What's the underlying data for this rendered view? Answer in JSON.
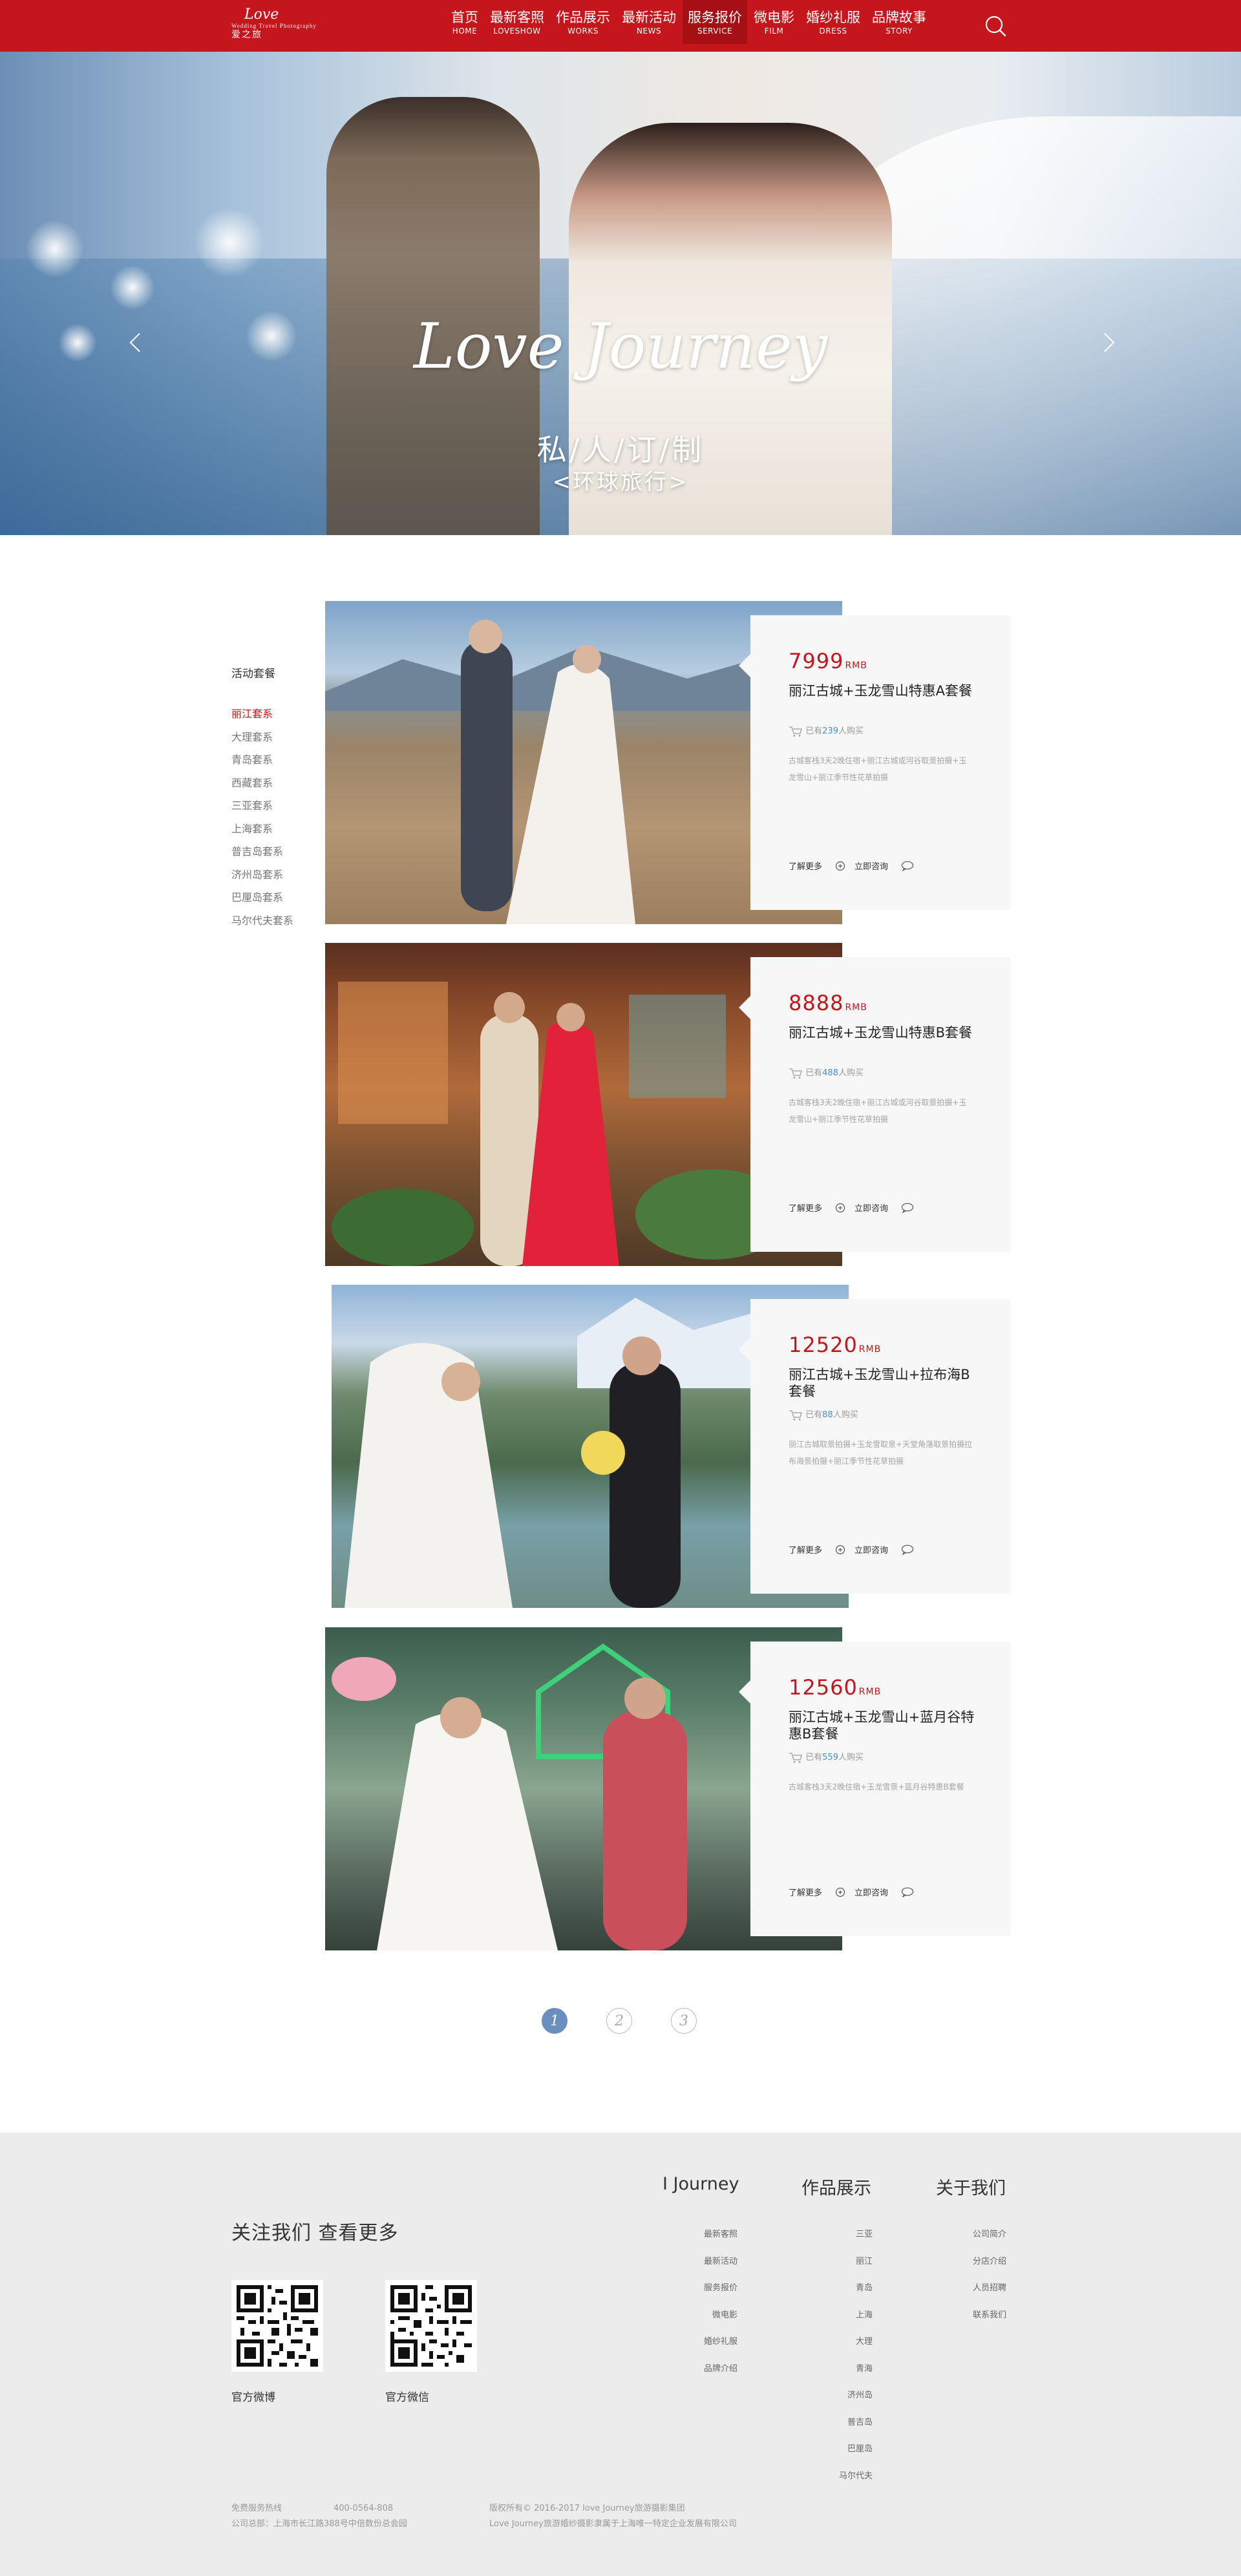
{
  "brand": {
    "script": "Love",
    "tagline": "Wedding Travel Photography",
    "name_cn": "爱之旅"
  },
  "nav": [
    {
      "cn": "首页",
      "en": "HOME",
      "active": false
    },
    {
      "cn": "最新客照",
      "en": "LOVESHOW",
      "active": false
    },
    {
      "cn": "作品展示",
      "en": "WORKS",
      "active": false
    },
    {
      "cn": "最新活动",
      "en": "NEWS",
      "active": false
    },
    {
      "cn": "服务报价",
      "en": "SERVICE",
      "active": true
    },
    {
      "cn": "微电影",
      "en": "FILM",
      "active": false
    },
    {
      "cn": "婚纱礼服",
      "en": "DRESS",
      "active": false
    },
    {
      "cn": "品牌故事",
      "en": "STORY",
      "active": false
    }
  ],
  "hero": {
    "script": "Love Journey",
    "title": "私/人/订/制",
    "subtitle": "<环球旅行>"
  },
  "sidebar": {
    "title": "活动套餐",
    "items": [
      "丽江套系",
      "大理套系",
      "青岛套系",
      "西藏套系",
      "三亚套系",
      "上海套系",
      "普吉岛套系",
      "济州岛套系",
      "巴厘岛套系",
      "马尔代夫套系"
    ]
  },
  "packages": [
    {
      "price": "7999",
      "unit": "RMB",
      "name": "丽江古城+玉龙雪山特惠A套餐",
      "buyers_pre": "已有",
      "buyers": "239",
      "buyers_post": "人购买",
      "desc": "古城客栈3天2晚住宿+丽江古城或河谷取景拍摄+玉龙雪山+丽江季节性花草拍摄",
      "more": "了解更多",
      "consult": "立即咨询"
    },
    {
      "price": "8888",
      "unit": "RMB",
      "name": "丽江古城+玉龙雪山特惠B套餐",
      "buyers_pre": "已有",
      "buyers": "488",
      "buyers_post": "人购买",
      "desc": "古城客栈3天2晚住宿+丽江古城或河谷取景拍摄+玉龙雪山+丽江季节性花草拍摄",
      "more": "了解更多",
      "consult": "立即咨询"
    },
    {
      "price": "12520",
      "unit": "RMB",
      "name": "丽江古城+玉龙雪山+拉布海B套餐",
      "buyers_pre": "已有",
      "buyers": "88",
      "buyers_post": "人购买",
      "desc": "丽江古城取景拍摄+玉龙雪取景+天堂角落取景拍摄拉布海景拍摄+丽江季节性花草拍摄",
      "more": "了解更多",
      "consult": "立即咨询"
    },
    {
      "price": "12560",
      "unit": "RMB",
      "name": "丽江古城+玉龙雪山+蓝月谷特惠B套餐",
      "buyers_pre": "已有",
      "buyers": "559",
      "buyers_post": "人购买",
      "desc": "古城客栈3天2晚住宿+玉龙雪景+蓝月谷特惠B套餐",
      "more": "了解更多",
      "consult": "立即咨询"
    }
  ],
  "pagination": [
    "1",
    "2",
    "3"
  ],
  "footer": {
    "follow": "关注我们 查看更多",
    "qr": [
      "官方微博",
      "官方微信"
    ],
    "columns": [
      {
        "title": "I Journey",
        "links": [
          "最新客照",
          "最新活动",
          "服务报价",
          "微电影",
          "婚纱礼服",
          "品牌介绍"
        ]
      },
      {
        "title": "作品展示",
        "links": [
          "三亚",
          "丽江",
          "青岛",
          "上海",
          "大理",
          "青海",
          "济州岛",
          "普吉岛",
          "巴厘岛",
          "马尔代夫"
        ]
      },
      {
        "title": "关于我们",
        "links": [
          "公司简介",
          "分店介绍",
          "人员招聘",
          "联系我们"
        ]
      }
    ],
    "hotline_label": "免费服务热线",
    "hotline": "400-0564-808",
    "address": "公司总部：上海市长江路388号中倍数份总会园",
    "copyright": "版权所有© 2016-2017 love Journey旅游摄影集团",
    "company": "Love Journey旅游婚纱摄影隶属于上海唯一特定企业发展有限公司"
  },
  "colors": {
    "brand_red": "#c4161c",
    "nav_active": "#a60f14",
    "link_blue": "#4a8ed0",
    "page_active": "#6a8fbf",
    "footer_bg": "#ececec"
  }
}
